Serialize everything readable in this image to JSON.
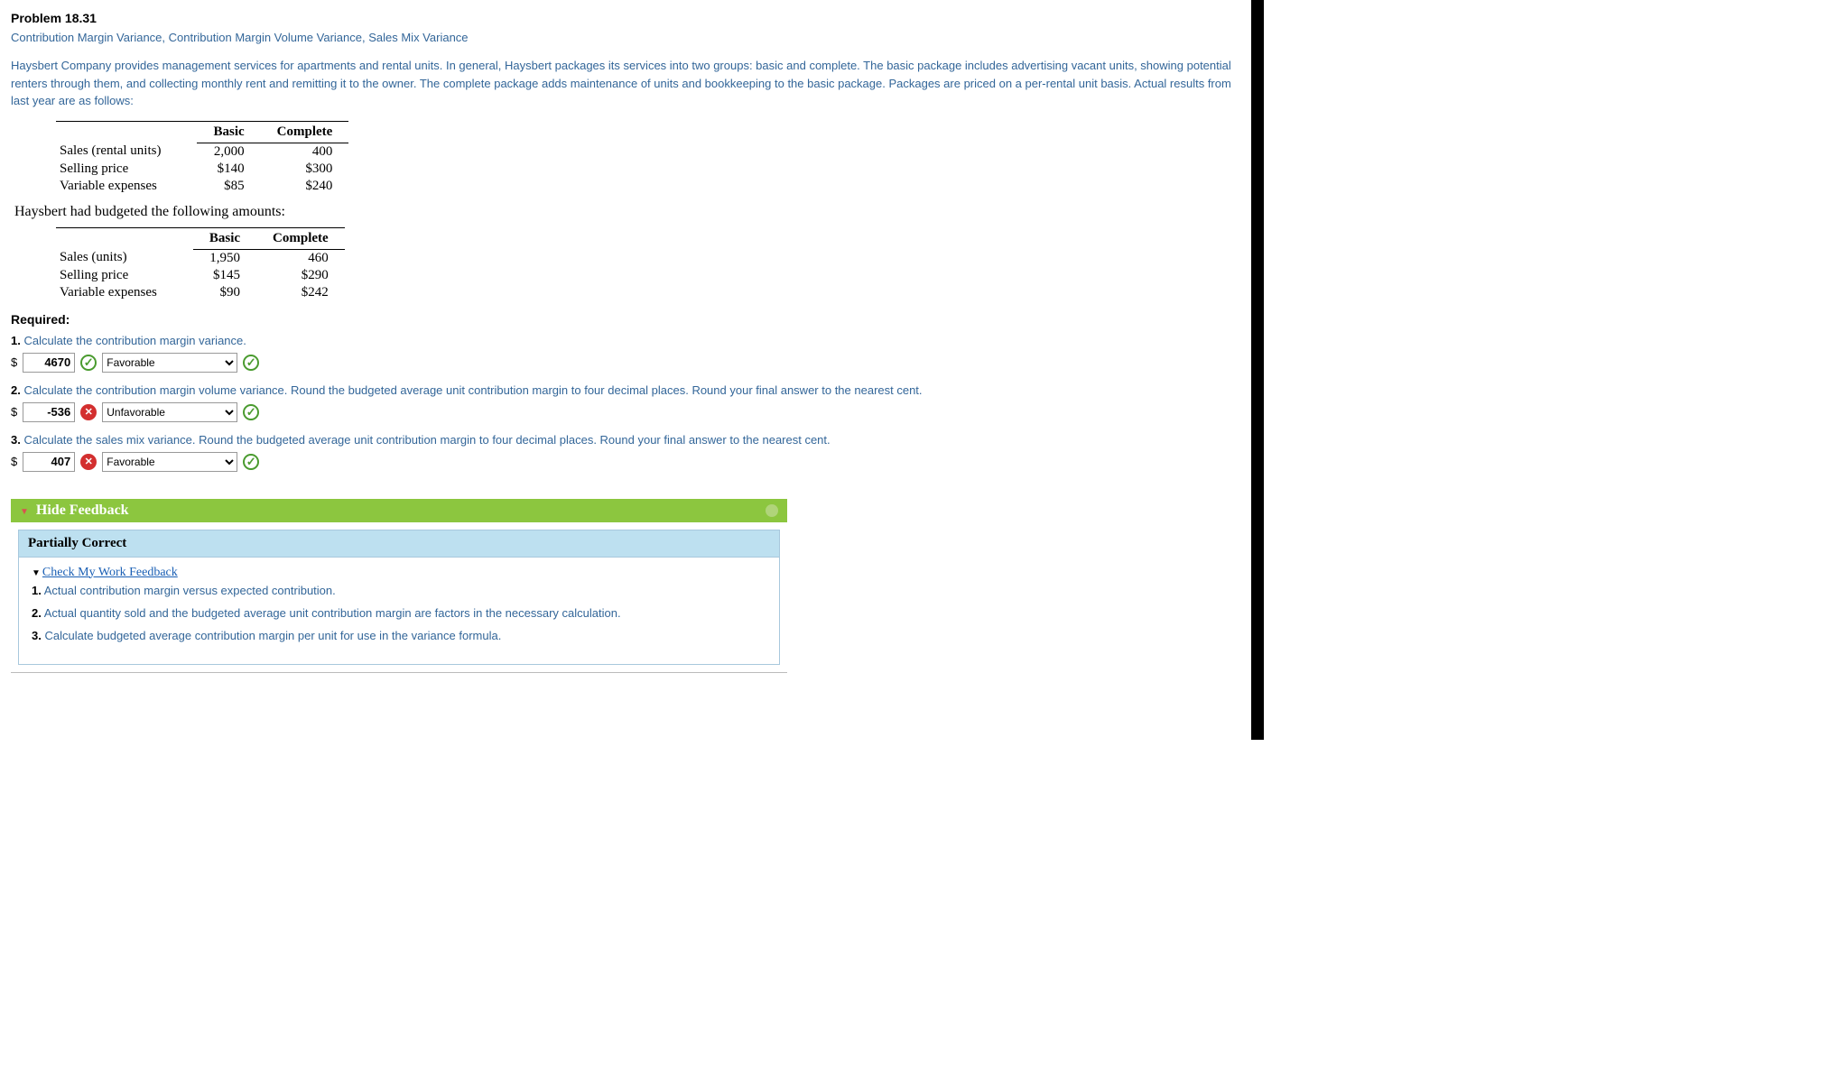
{
  "problem": {
    "title": "Problem 18.31",
    "subtitle": "Contribution Margin Variance, Contribution Margin Volume Variance, Sales Mix Variance",
    "intro": "Haysbert Company provides management services for apartments and rental units. In general, Haysbert packages its services into two groups: basic and complete. The basic package includes advertising vacant units, showing potential renters through them, and collecting monthly rent and remitting it to the owner. The complete package adds maintenance of units and bookkeeping to the basic package. Packages are priced on a per-rental unit basis. Actual results from last year are as follows:"
  },
  "table_actual": {
    "col1": "Basic",
    "col2": "Complete",
    "rows": [
      {
        "label": "Sales (rental units)",
        "c1": "2,000",
        "c2": "400"
      },
      {
        "label": "Selling price",
        "c1": "$140",
        "c2": "$300"
      },
      {
        "label": "Variable expenses",
        "c1": "$85",
        "c2": "$240"
      }
    ]
  },
  "intertext": "Haysbert had budgeted the following amounts:",
  "table_budget": {
    "col1": "Basic",
    "col2": "Complete",
    "rows": [
      {
        "label": "Sales (units)",
        "c1": "1,950",
        "c2": "460"
      },
      {
        "label": "Selling price",
        "c1": "$145",
        "c2": "$290"
      },
      {
        "label": "Variable expenses",
        "c1": "$90",
        "c2": "$242"
      }
    ]
  },
  "required_label": "Required:",
  "questions": {
    "q1": {
      "num": "1.",
      "text": " Calculate the contribution margin variance.",
      "value": "4670",
      "select": "Favorable",
      "input_icon": "check",
      "select_icon": "check"
    },
    "q2": {
      "num": "2.",
      "text": " Calculate the contribution margin volume variance. Round the budgeted average unit contribution margin to four decimal places. Round your final answer to the nearest cent.",
      "value": "-536",
      "select": "Unfavorable",
      "input_icon": "cross",
      "select_icon": "check"
    },
    "q3": {
      "num": "3.",
      "text": " Calculate the sales mix variance. Round the budgeted average unit contribution margin to four decimal places. Round your final answer to the nearest cent.",
      "value": "407",
      "select": "Favorable",
      "input_icon": "cross",
      "select_icon": "check"
    }
  },
  "dollar": "$",
  "select_options": [
    "Favorable",
    "Unfavorable"
  ],
  "feedback": {
    "header": "Hide Feedback",
    "status": "Partially Correct",
    "link": "Check My Work Feedback",
    "items": [
      {
        "n": "1.",
        "t": " Actual contribution margin versus expected contribution."
      },
      {
        "n": "2.",
        "t": " Actual quantity sold and the budgeted average unit contribution margin are factors in the necessary calculation."
      },
      {
        "n": "3.",
        "t": " Calculate budgeted average contribution margin per unit for use in the variance formula."
      }
    ]
  }
}
